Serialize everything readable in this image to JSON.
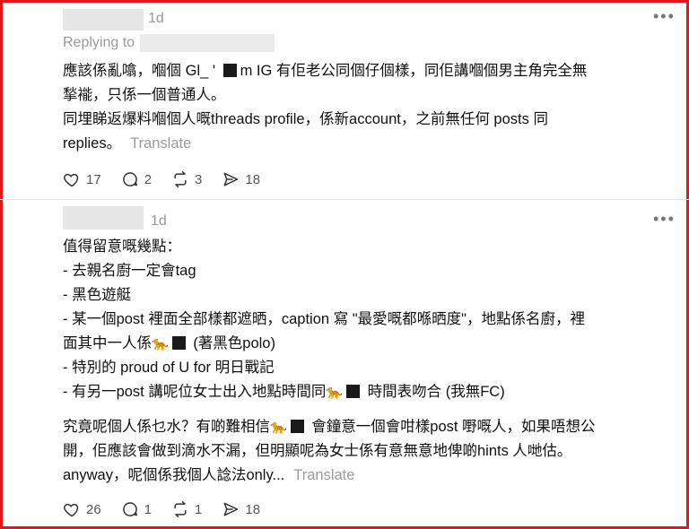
{
  "posts": [
    {
      "time": "1d",
      "replying_to": "Replying to",
      "lines": [
        "應該係亂噏，嗰個 Gl_ ' ",
        "m IG 有佢老公同個仔個樣，同佢講嗰個男主角完全無",
        "揫褦，只係一個普通人。",
        "同埋睇返爆料嗰個人嘅threads profile，係新account，之前無任何 posts 同",
        "replies。"
      ],
      "translate": "Translate",
      "likes": "17",
      "comments": "2",
      "reposts": "3",
      "shares": "18"
    },
    {
      "time": "1d",
      "lines": [
        "值得留意嘅幾點：",
        "- 去親名廚一定會tag",
        "- 黑色遊艇",
        "- 某一個post 裡面全部樣都遮晒，caption 寫 \"最愛嘅都喺晒度\"，地點係名廚，裡",
        "面其中一人係",
        " (著黑色polo)",
        "- 特別的 proud of U for 明日戰記",
        "- 有另一post 講呢位女士出入地點時間同",
        " 時間表吻合 (我無FC)",
        "究竟呢個人係乜水？有啲難相信",
        " 會鐘意一個會咁樣post 嘢嘅人，如果唔想公",
        "開，佢應該會做到滴水不漏，但明顯呢為女士係有意無意地俾啲hints 人哋估。",
        "anyway，呢個係我個人諗法only..."
      ],
      "translate": "Translate",
      "likes": "26",
      "comments": "1",
      "reposts": "1",
      "shares": "18"
    }
  ],
  "icons": [
    "heart-icon",
    "comment-icon",
    "repost-icon",
    "share-icon",
    "more-icon",
    "tiger-emoji"
  ],
  "colors": {
    "border": "#e8141c",
    "muted": "#9a9a9a",
    "text": "#111111"
  }
}
